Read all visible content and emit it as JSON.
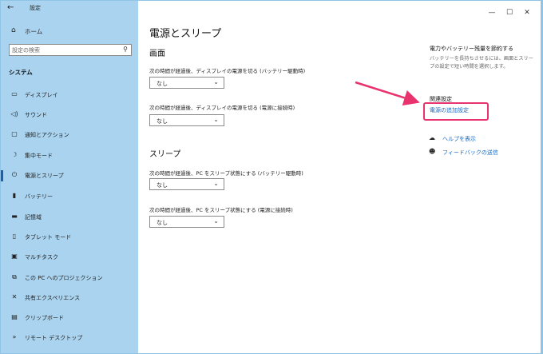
{
  "window": {
    "title": "設定"
  },
  "sidebar": {
    "home_label": "ホーム",
    "search_placeholder": "設定の検索",
    "section_heading": "システム",
    "items": [
      {
        "label": "ディスプレイ",
        "icon": "display-icon"
      },
      {
        "label": "サウンド",
        "icon": "speaker-icon"
      },
      {
        "label": "通知とアクション",
        "icon": "notification-icon"
      },
      {
        "label": "集中モード",
        "icon": "moon-icon"
      },
      {
        "label": "電源とスリープ",
        "icon": "power-icon",
        "active": true
      },
      {
        "label": "バッテリー",
        "icon": "battery-icon"
      },
      {
        "label": "記憶域",
        "icon": "storage-icon"
      },
      {
        "label": "タブレット モード",
        "icon": "tablet-icon"
      },
      {
        "label": "マルチタスク",
        "icon": "multitask-icon"
      },
      {
        "label": "この PC へのプロジェクション",
        "icon": "projection-icon"
      },
      {
        "label": "共有エクスペリエンス",
        "icon": "share-icon"
      },
      {
        "label": "クリップボード",
        "icon": "clipboard-icon"
      },
      {
        "label": "リモート デスクトップ",
        "icon": "remote-desktop-icon"
      }
    ]
  },
  "main": {
    "page_title": "電源とスリープ",
    "screen": {
      "heading": "画面",
      "battery_label": "次の時間が経過後、ディスプレイの電源を切る (バッテリー駆動時)",
      "battery_value": "なし",
      "plugged_label": "次の時間が経過後、ディスプレイの電源を切る (電源に接続時)",
      "plugged_value": "なし"
    },
    "sleep": {
      "heading": "スリープ",
      "battery_label": "次の時間が経過後、PC をスリープ状態にする (バッテリー駆動時)",
      "battery_value": "なし",
      "plugged_label": "次の時間が経過後、PC をスリープ状態にする (電源に接続時)",
      "plugged_value": "なし"
    }
  },
  "right": {
    "save_heading": "電力やバッテリー残量を節約する",
    "save_desc": "バッテリーを長持ちさせるには、画面とスリープの設定で短い時間を選択します。",
    "related_heading": "関連設定",
    "additional_power_link": "電源の追加設定",
    "help_label": "ヘルプを表示",
    "feedback_label": "フィードバックの送信"
  },
  "colors": {
    "sidebar_bg": "#a9d3ef",
    "accent_link": "#1a69c4",
    "annotation": "#e8336e"
  }
}
